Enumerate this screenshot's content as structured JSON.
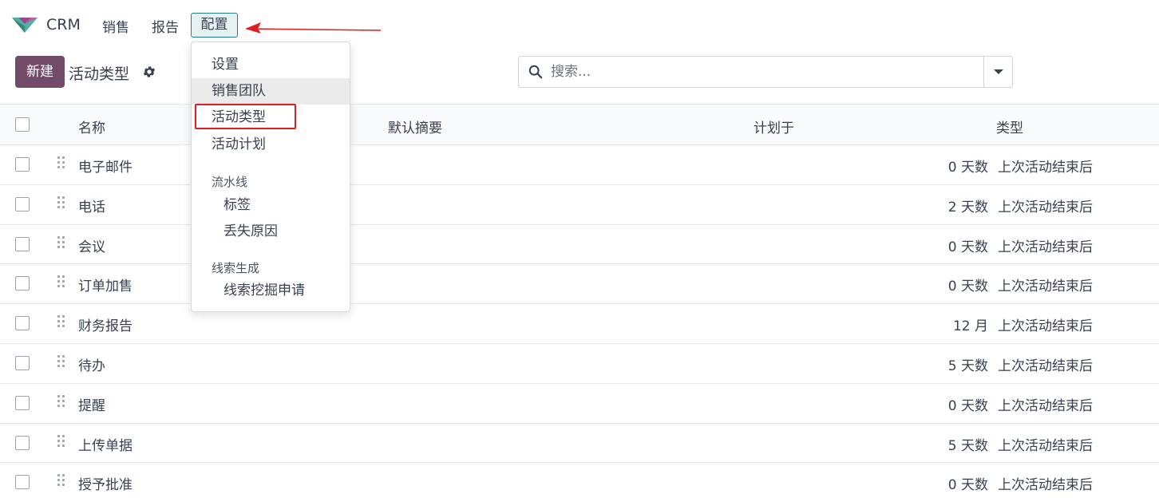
{
  "topnav": {
    "app_name": "CRM",
    "menu": {
      "sales": "销售",
      "reports": "报告",
      "config": "配置"
    }
  },
  "control": {
    "new_button": "新建",
    "title": "活动类型",
    "search_placeholder": "搜索..."
  },
  "table": {
    "headers": {
      "name": "名称",
      "summary": "默认摘要",
      "planned": "计划于",
      "type": "类型"
    },
    "rows": [
      {
        "name": "电子邮件",
        "delay": "0 天数",
        "type": "上次活动结束后"
      },
      {
        "name": "电话",
        "delay": "2 天数",
        "type": "上次活动结束后"
      },
      {
        "name": "会议",
        "delay": "0 天数",
        "type": "上次活动结束后"
      },
      {
        "name": "订单加售",
        "delay": "0 天数",
        "type": "上次活动结束后"
      },
      {
        "name": "财务报告",
        "delay": "12 月",
        "type": "上次活动结束后"
      },
      {
        "name": "待办",
        "delay": "5 天数",
        "type": "上次活动结束后"
      },
      {
        "name": "提醒",
        "delay": "0 天数",
        "type": "上次活动结束后"
      },
      {
        "name": "上传单据",
        "delay": "5 天数",
        "type": "上次活动结束后"
      },
      {
        "name": "授予批准",
        "delay": "0 天数",
        "type": "上次活动结束后"
      }
    ]
  },
  "config_menu": {
    "settings": "设置",
    "sales_teams": "销售团队",
    "activity_types": "活动类型",
    "activity_plans": "活动计划",
    "pipeline_header": "流水线",
    "tags": "标签",
    "lost_reasons": "丢失原因",
    "leadgen_header": "线索生成",
    "lead_mining_requests": "线索挖掘申请"
  },
  "colors": {
    "brand": "#714b67",
    "accent": "#1e7f86",
    "annotation": "#e11d1d"
  }
}
